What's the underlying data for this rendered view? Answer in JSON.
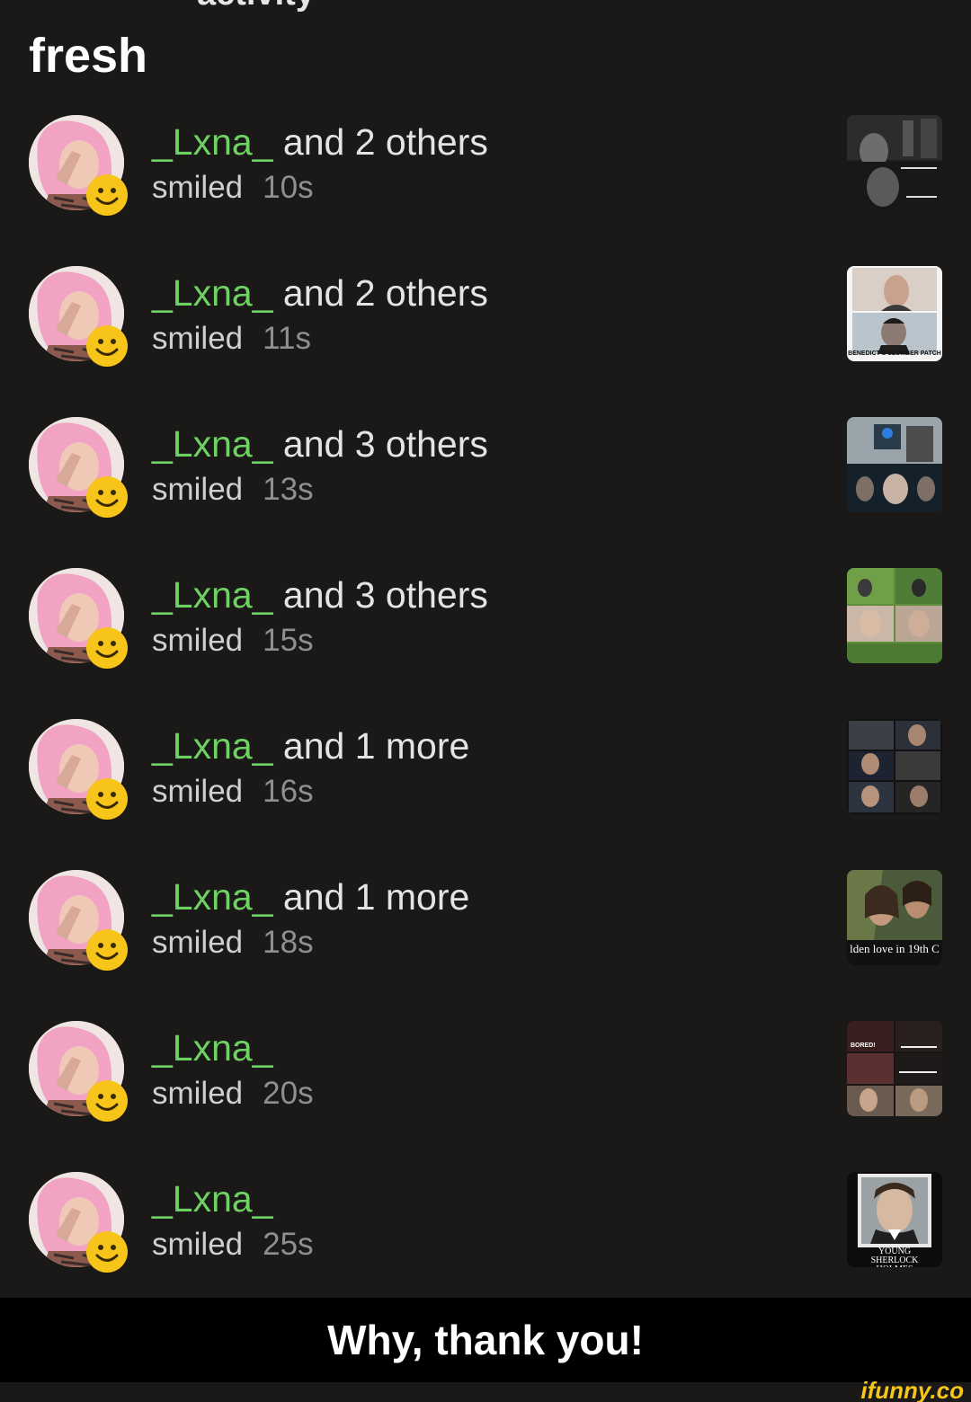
{
  "header": {
    "top_partial": "activity",
    "section_title": "fresh"
  },
  "colors": {
    "background": "#1b1918",
    "username": "#6ed263",
    "text": "#e4e4e4",
    "muted": "#8f8f8f",
    "smile_badge": "#f7c51a"
  },
  "activity": [
    {
      "username": "_Lxna_",
      "rest": " and 2 others",
      "action": "smiled",
      "time": "10s",
      "thumb": "sherlock-meme-1"
    },
    {
      "username": "_Lxna_",
      "rest": " and 2 others",
      "action": "smiled",
      "time": "11s",
      "thumb": "sherlock-meme-2",
      "thumb_caption": "BENEDICT'S SLUMBER PATCH"
    },
    {
      "username": "_Lxna_",
      "rest": " and 3 others",
      "action": "smiled",
      "time": "13s",
      "thumb": "sherlock-meme-3"
    },
    {
      "username": "_Lxna_",
      "rest": " and 3 others",
      "action": "smiled",
      "time": "15s",
      "thumb": "sherlock-meme-4"
    },
    {
      "username": "_Lxna_",
      "rest": " and 1 more",
      "action": "smiled",
      "time": "16s",
      "thumb": "sherlock-meme-5"
    },
    {
      "username": "_Lxna_",
      "rest": " and 1 more",
      "action": "smiled",
      "time": "18s",
      "thumb": "period-drama-meme",
      "thumb_caption": "lden love in 19th C"
    },
    {
      "username": "_Lxna_",
      "rest": "",
      "action": "smiled",
      "time": "20s",
      "thumb": "sherlock-meme-7",
      "thumb_caption": "BORED!"
    },
    {
      "username": "_Lxna_",
      "rest": "",
      "action": "smiled",
      "time": "25s",
      "thumb": "young-sherlock-meme",
      "thumb_caption": "YOUNG SHERLOCK HOLMES"
    }
  ],
  "caption": {
    "text": "Why, thank you!"
  },
  "watermark": "ifunny.co"
}
